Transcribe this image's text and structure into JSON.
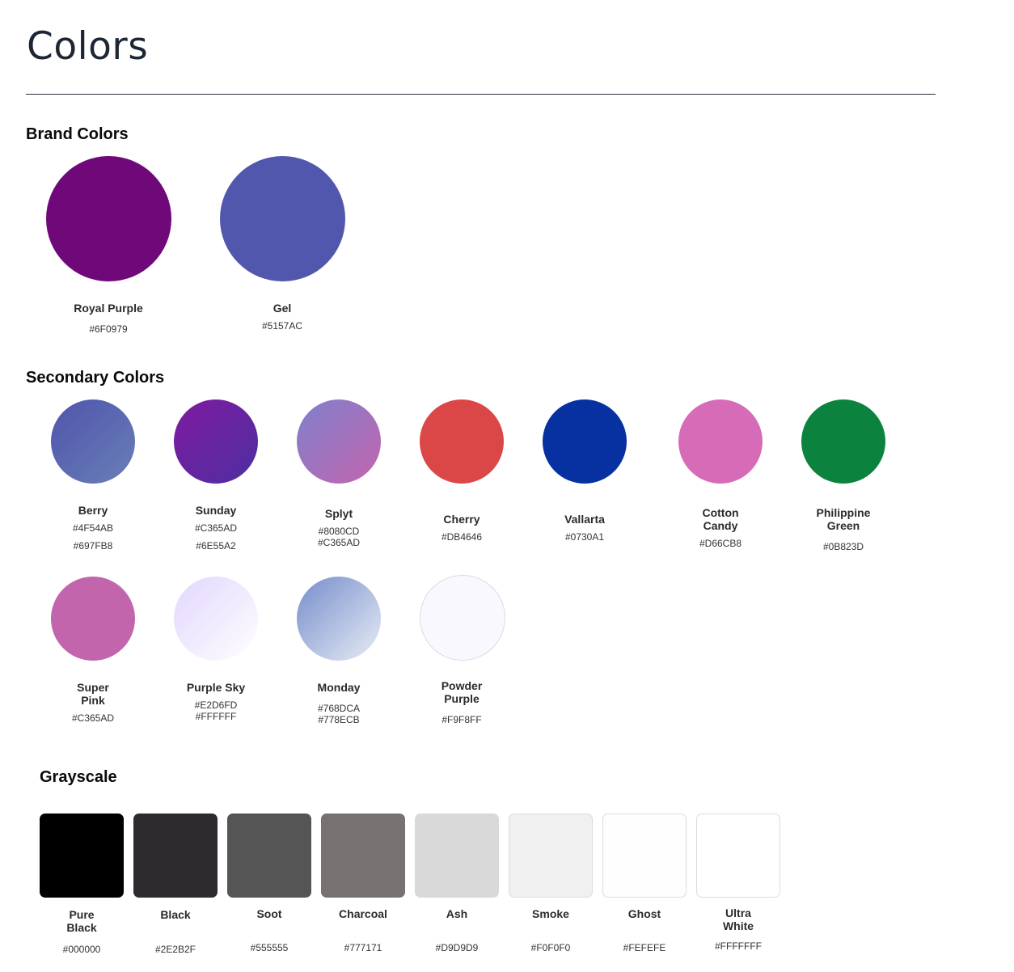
{
  "page": {
    "title": "Colors"
  },
  "brand": {
    "title": "Brand Colors",
    "items": [
      {
        "name": "Royal Purple",
        "hex": "#6F0979",
        "color": "#6F0979"
      },
      {
        "name": "Gel",
        "hex": "#5157AC",
        "color": "#5157AC"
      }
    ]
  },
  "secondary": {
    "title": "Secondary Colors",
    "items": [
      {
        "name": "Berry",
        "hex": "#4F54AB",
        "hex2": "#697FB8",
        "from": "#4F54AB",
        "to": "#697FB8"
      },
      {
        "name": "Sunday",
        "hex": "#C365AD",
        "hex2": "#6E55A2",
        "from": "#7E1AA0",
        "to": "#4E2FA0"
      },
      {
        "name": "Splyt",
        "hex": "#8080CD\n#C365AD",
        "from": "#8080CD",
        "to": "#C365AD"
      },
      {
        "name": "Cherry",
        "hex": "#DB4646",
        "color": "#DB4646"
      },
      {
        "name": "Vallarta",
        "hex": "#0730A1",
        "color": "#0730A1"
      },
      {
        "name": "Cotton\nCandy",
        "hex": "#D66CB8",
        "color": "#D66CB8"
      },
      {
        "name": "Philippine\nGreen",
        "hex": "#0B823D",
        "color": "#0B823D"
      },
      {
        "name": "Super\nPink",
        "hex": "#C365AD",
        "color": "#C365AD"
      },
      {
        "name": "Purple Sky",
        "hex": "#E2D6FD\n#FFFFFF",
        "from": "#E2D6FD",
        "to": "#FFFFFF"
      },
      {
        "name": "Monday",
        "hex": "#768DCA\n#778ECB",
        "from": "#768DCA",
        "to": "#E8ECF6"
      },
      {
        "name": "Powder\nPurple",
        "hex": "#F9F8FF",
        "color": "#F9F8FF"
      }
    ]
  },
  "grayscale": {
    "title": "Grayscale",
    "items": [
      {
        "name": "Pure\nBlack",
        "hex": "#000000",
        "color": "#000000"
      },
      {
        "name": "Black",
        "hex": "#2E2B2F",
        "color": "#2E2B2F"
      },
      {
        "name": "Soot",
        "hex": "#555555",
        "color": "#555555"
      },
      {
        "name": "Charcoal",
        "hex": "#777171",
        "color": "#777171"
      },
      {
        "name": "Ash",
        "hex": "#D9D9D9",
        "color": "#D9D9D9"
      },
      {
        "name": "Smoke",
        "hex": "#F0F0F0",
        "color": "#F0F0F0"
      },
      {
        "name": "Ghost",
        "hex": "#FEFEFE",
        "color": "#FEFEFE"
      },
      {
        "name": "Ultra\nWhite",
        "hex": "#FFFFFFF",
        "color": "#FFFFFF"
      }
    ]
  }
}
